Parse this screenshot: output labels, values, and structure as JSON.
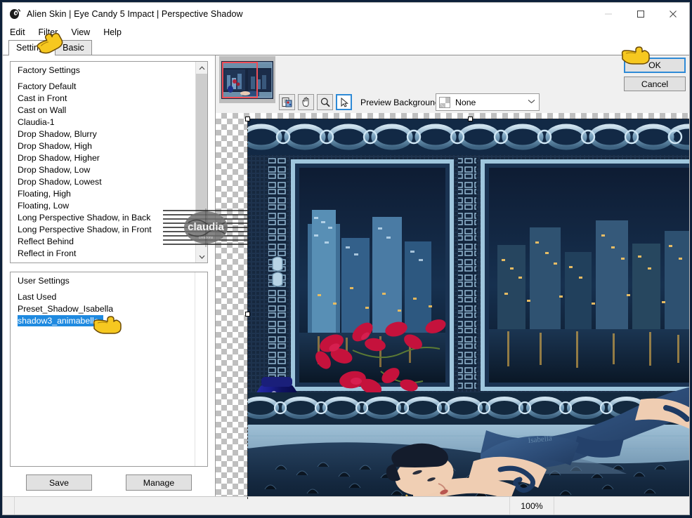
{
  "window": {
    "title": "Alien Skin | Eye Candy 5 Impact | Perspective Shadow",
    "icon": "alien-head-icon",
    "minimize": "minimize-icon",
    "maximize": "maximize-icon",
    "close": "close-icon"
  },
  "menubar": {
    "items": [
      {
        "label": "Edit"
      },
      {
        "label": "Filter"
      },
      {
        "label": "View"
      },
      {
        "label": "Help"
      }
    ]
  },
  "tabs": [
    {
      "label": "Settings",
      "active": true
    },
    {
      "label": "Basic",
      "active": false
    }
  ],
  "factory_settings": {
    "header": "Factory Settings",
    "items": [
      "Factory Default",
      "Cast in Front",
      "Cast on Wall",
      "Claudia-1",
      "Drop Shadow, Blurry",
      "Drop Shadow, High",
      "Drop Shadow, Higher",
      "Drop Shadow, Low",
      "Drop Shadow, Lowest",
      "Floating, High",
      "Floating, Low",
      "Long Perspective Shadow, in Back",
      "Long Perspective Shadow, in Front",
      "Reflect Behind",
      "Reflect in Front"
    ],
    "scroll_up_icon": "chevron-up-icon",
    "scroll_down_icon": "chevron-down-icon"
  },
  "user_settings": {
    "header": "User Settings",
    "items": [
      {
        "label": "Last Used",
        "selected": false
      },
      {
        "label": "Preset_Shadow_Isabella",
        "selected": false
      },
      {
        "label": "shadow3_animabelle",
        "selected": true
      }
    ]
  },
  "preset_buttons": {
    "save": "Save",
    "manage": "Manage"
  },
  "toolbar": {
    "navigator_icon": "navigator-thumbnail",
    "tools": [
      {
        "name": "preview-compare-icon",
        "active": false
      },
      {
        "name": "hand-pan-icon",
        "active": false
      },
      {
        "name": "zoom-magnifier-icon",
        "active": false
      },
      {
        "name": "arrow-select-icon",
        "active": true
      }
    ],
    "preview_background_label": "Preview Background:",
    "preview_background_value": "None",
    "preview_background_swatch": "checkerboard-swatch",
    "preview_background_caret": "chevron-down-icon"
  },
  "dialog_buttons": {
    "ok": "OK",
    "cancel": "Cancel"
  },
  "statusbar": {
    "zoom": "100%"
  },
  "watermark": {
    "text": "claudia"
  },
  "cursors": {
    "filter_menu_pointer": "pointing-hand-cursor",
    "preset_pointer": "pointing-hand-cursor",
    "ok_pointer": "pointing-hand-cursor"
  },
  "colors": {
    "accent": "#1f8ae0",
    "focus_border": "#2e8ad6",
    "viewport_marker": "#ef4f58",
    "window_bg": "#f0f0f0",
    "desktop": "#0d2039"
  }
}
